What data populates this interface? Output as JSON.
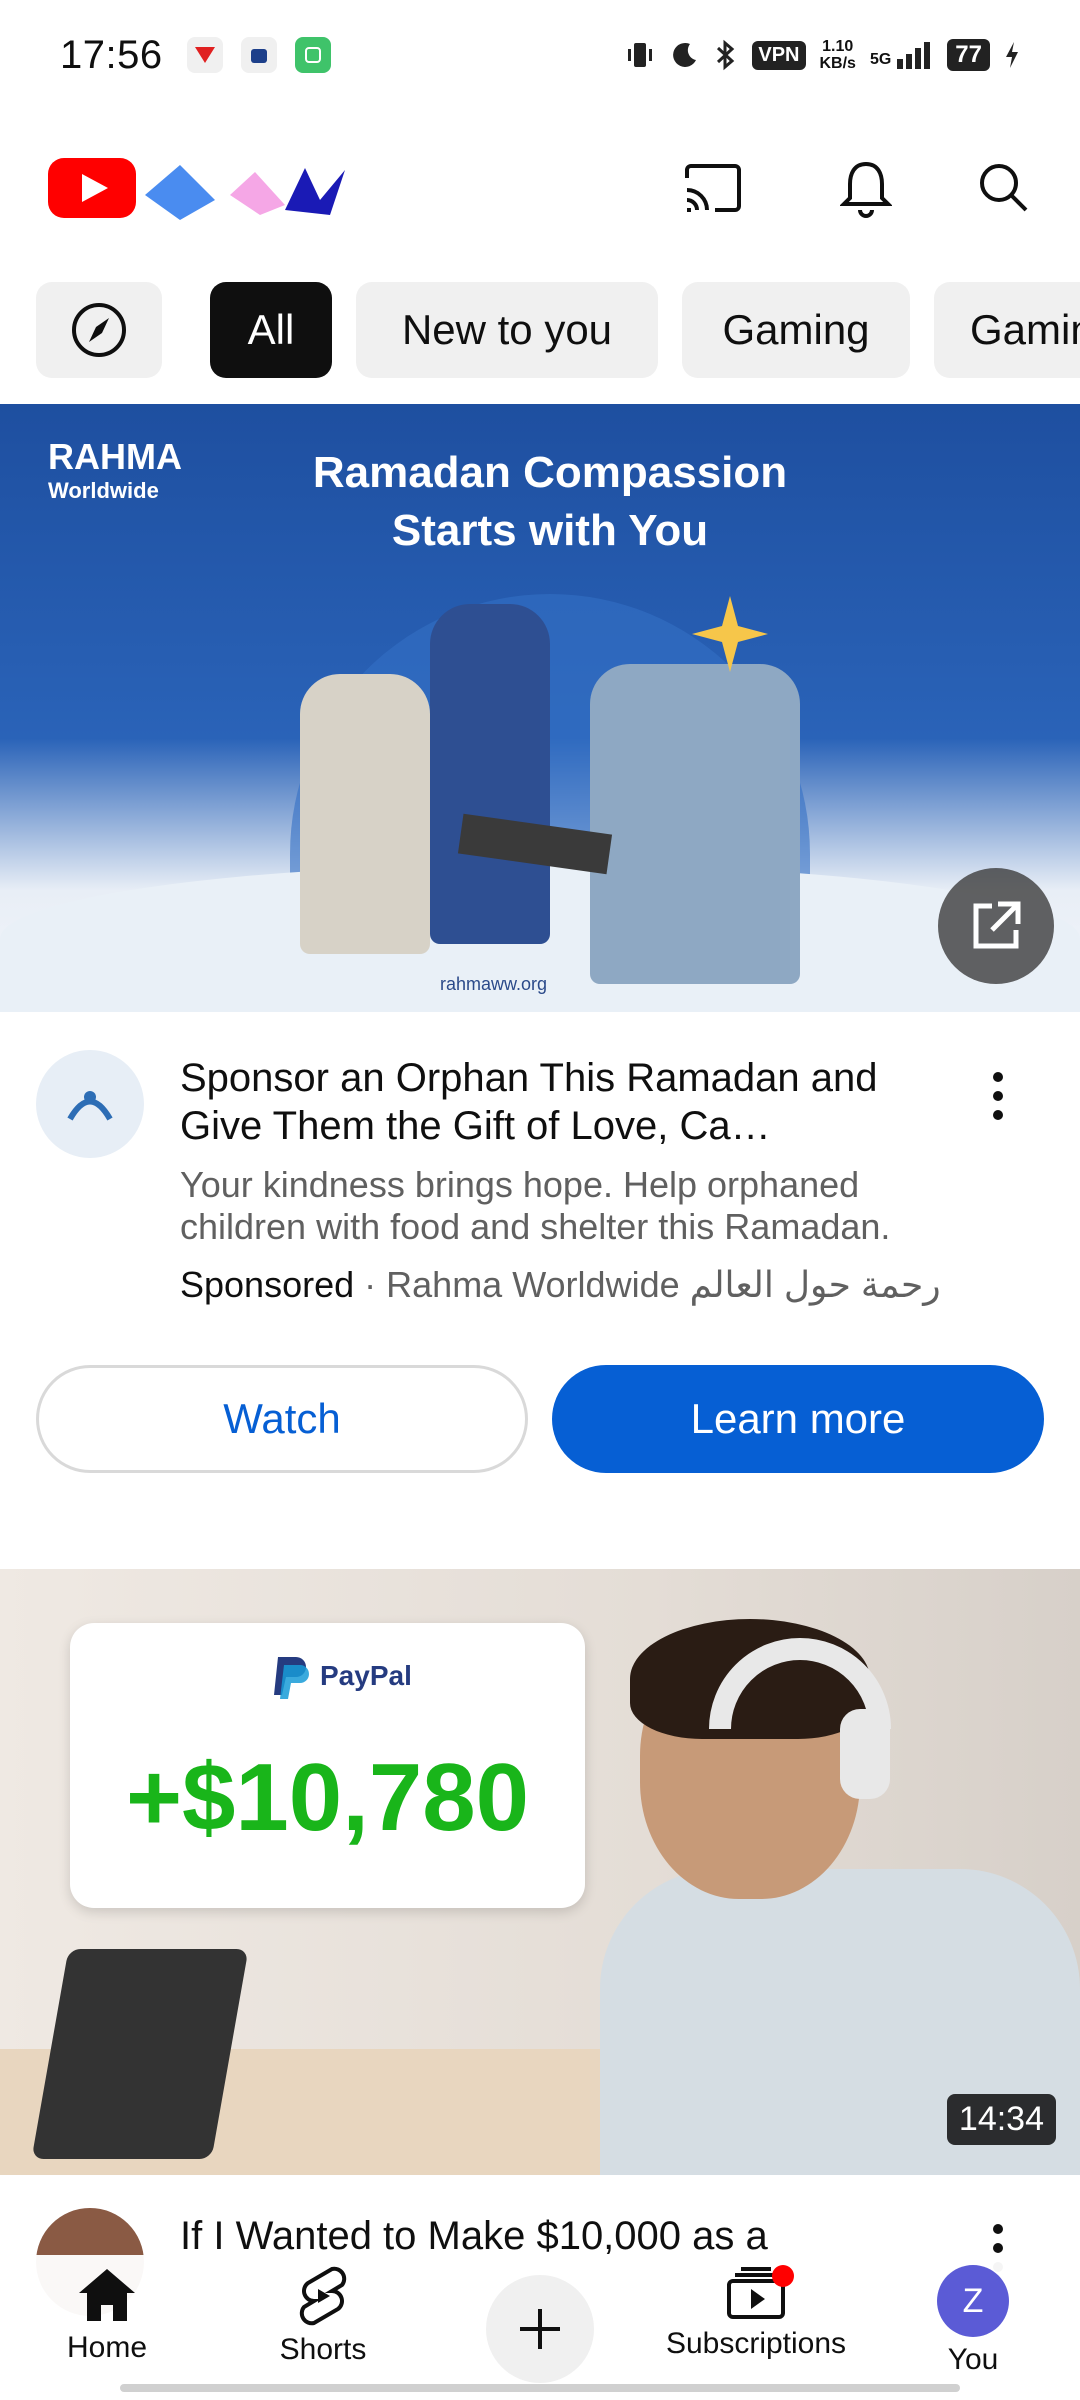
{
  "status_bar": {
    "time": "17:56",
    "vpn": "VPN",
    "speed_value": "1.10",
    "speed_unit": "KB/s",
    "network": "5G",
    "battery": "77"
  },
  "app_bar": {
    "logo": "youtube-logo",
    "icons": [
      "cast-icon",
      "bell-icon",
      "search-icon"
    ]
  },
  "chips": [
    {
      "label": "",
      "icon": "explore-compass-icon"
    },
    {
      "label": "All",
      "active": true
    },
    {
      "label": "New to you"
    },
    {
      "label": "Gaming"
    },
    {
      "label": "Gamin"
    }
  ],
  "ad": {
    "brand_name": "RAHMA",
    "brand_sub": "Worldwide",
    "headline": "Ramadan Compassion Starts with You",
    "url": "rahmaww.org",
    "title": "Sponsor an Orphan This Ramadan and Give Them the Gift of Love, Ca…",
    "description": "Your kindness brings hope. Help orphaned children with food and shelter this Ramadan.",
    "sponsored_label": "Sponsored",
    "advertiser": "Rahma Worldwide رحمة حول العالم",
    "watch_label": "Watch",
    "learn_more_label": "Learn more"
  },
  "video": {
    "paypal_label": "PayPal",
    "amount": "+$10,780",
    "duration": "14:34",
    "title": "If I Wanted to Make $10,000 as a"
  },
  "bottom_nav": {
    "home": "Home",
    "shorts": "Shorts",
    "subscriptions": "Subscriptions",
    "you": "You",
    "you_initial": "Z"
  },
  "colors": {
    "youtube_red": "#ff0000",
    "primary_blue": "#065fd4",
    "paypal_green": "#19b51a",
    "chip_bg": "#f0f0f0"
  }
}
